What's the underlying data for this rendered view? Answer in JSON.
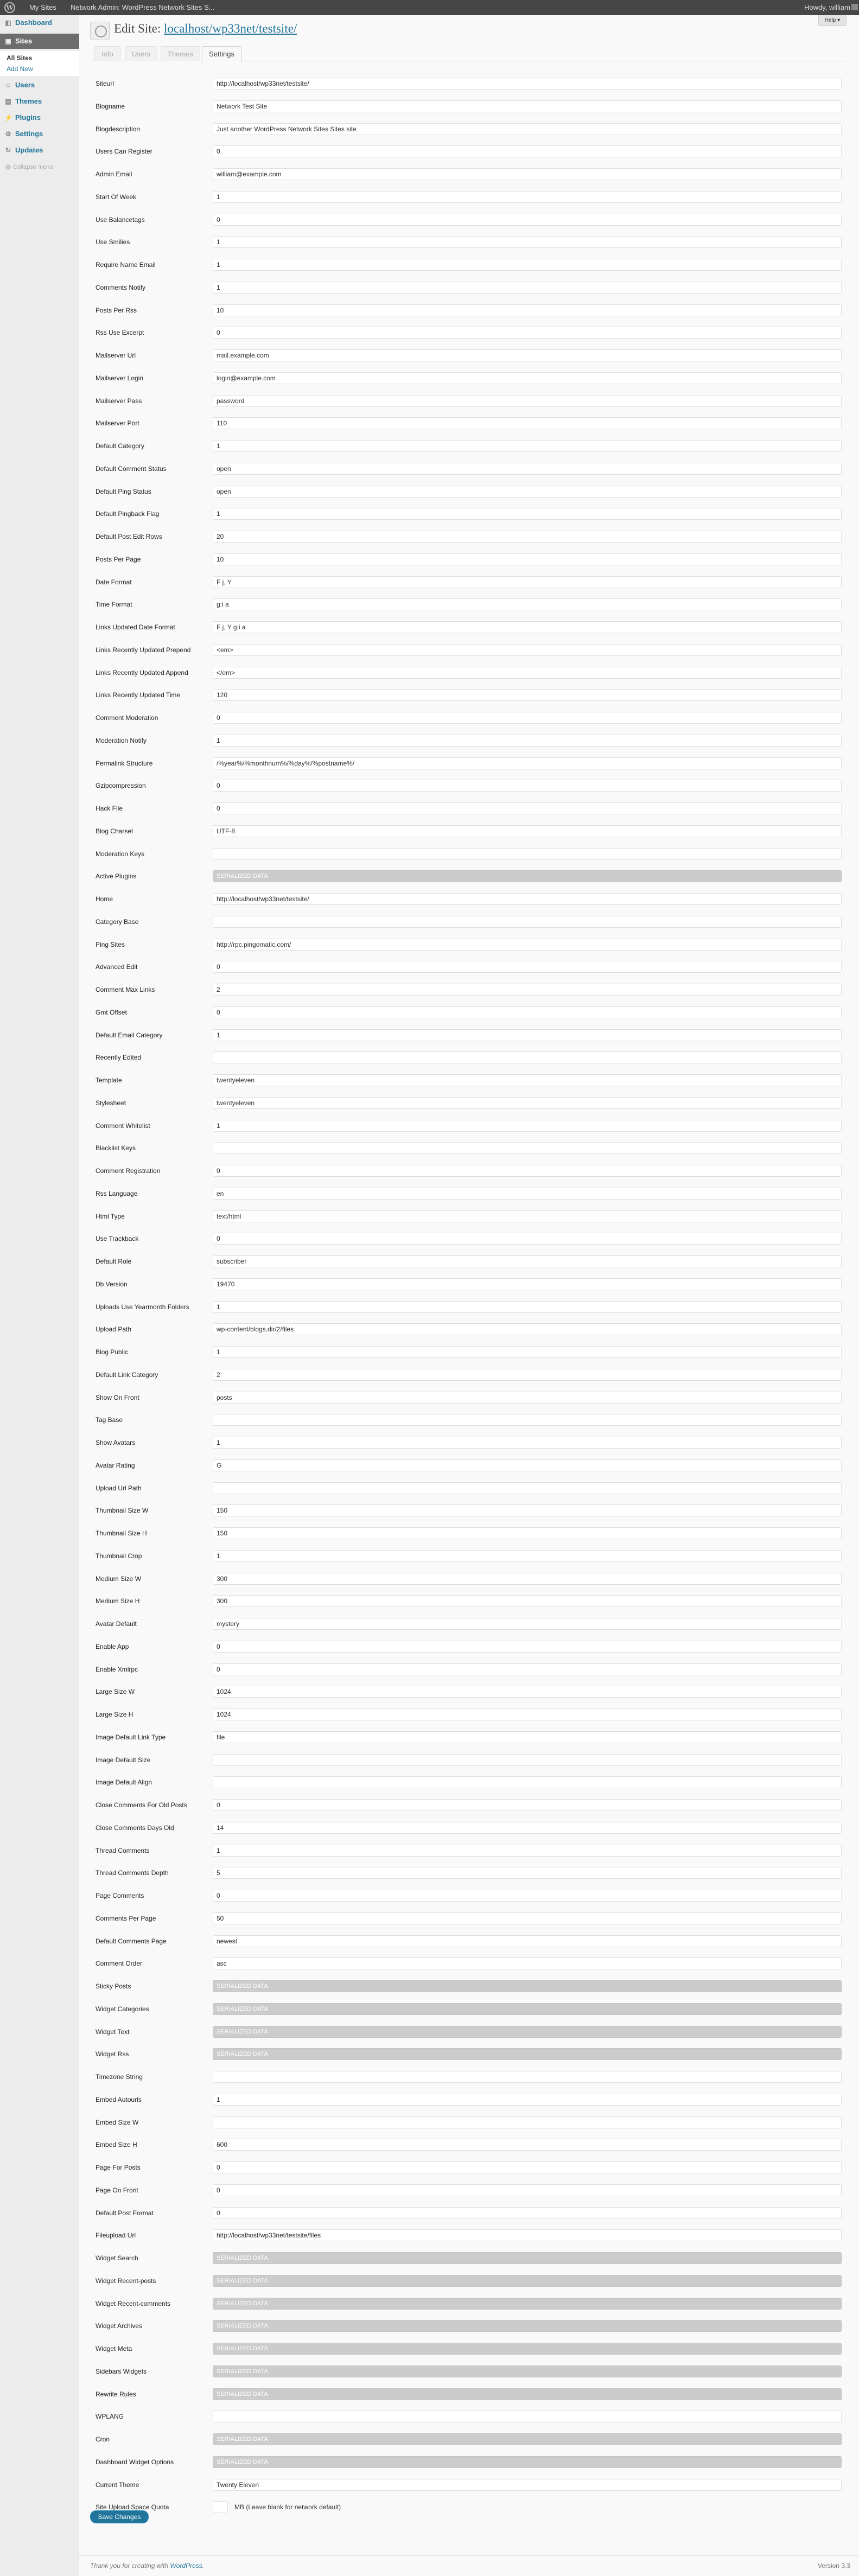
{
  "adminbar": {
    "logo": "W",
    "items": [
      "My Sites",
      "Network Admin: WordPress Network Sites S..."
    ],
    "howdy": "Howdy, william"
  },
  "sidebar": {
    "items": [
      {
        "label": "Dashboard",
        "icon": "dashboard-icon"
      },
      {
        "label": "Sites",
        "icon": "sites-icon"
      },
      {
        "label": "Users",
        "icon": "users-icon"
      },
      {
        "label": "Themes",
        "icon": "themes-icon"
      },
      {
        "label": "Plugins",
        "icon": "plugins-icon"
      },
      {
        "label": "Settings",
        "icon": "settings-icon"
      },
      {
        "label": "Updates",
        "icon": "updates-icon"
      }
    ],
    "submenu": [
      "All Sites",
      "Add New"
    ],
    "collapse": "Collapse menu"
  },
  "header": {
    "title_prefix": "Edit Site:",
    "title_link": "localhost/wp33net/testsite/",
    "help": "Help"
  },
  "tabs": [
    "Info",
    "Users",
    "Themes",
    "Settings"
  ],
  "fields": [
    {
      "label": "Siteurl",
      "value": "http://localhost/wp33net/testsite/"
    },
    {
      "label": "Blogname",
      "value": "Network Test Site"
    },
    {
      "label": "Blogdescription",
      "value": "Just another WordPress Network Sites Sites site"
    },
    {
      "label": "Users Can Register",
      "value": "0"
    },
    {
      "label": "Admin Email",
      "value": "william@example.com"
    },
    {
      "label": "Start Of Week",
      "value": "1"
    },
    {
      "label": "Use Balancetags",
      "value": "0"
    },
    {
      "label": "Use Smilies",
      "value": "1"
    },
    {
      "label": "Require Name Email",
      "value": "1"
    },
    {
      "label": "Comments Notify",
      "value": "1"
    },
    {
      "label": "Posts Per Rss",
      "value": "10"
    },
    {
      "label": "Rss Use Excerpt",
      "value": "0"
    },
    {
      "label": "Mailserver Url",
      "value": "mail.example.com"
    },
    {
      "label": "Mailserver Login",
      "value": "login@example.com"
    },
    {
      "label": "Mailserver Pass",
      "value": "password"
    },
    {
      "label": "Mailserver Port",
      "value": "110"
    },
    {
      "label": "Default Category",
      "value": "1"
    },
    {
      "label": "Default Comment Status",
      "value": "open"
    },
    {
      "label": "Default Ping Status",
      "value": "open"
    },
    {
      "label": "Default Pingback Flag",
      "value": "1"
    },
    {
      "label": "Default Post Edit Rows",
      "value": "20"
    },
    {
      "label": "Posts Per Page",
      "value": "10"
    },
    {
      "label": "Date Format",
      "value": "F j, Y"
    },
    {
      "label": "Time Format",
      "value": "g:i a"
    },
    {
      "label": "Links Updated Date Format",
      "value": "F j, Y g:i a"
    },
    {
      "label": "Links Recently Updated Prepend",
      "value": "<em>"
    },
    {
      "label": "Links Recently Updated Append",
      "value": "</em>"
    },
    {
      "label": "Links Recently Updated Time",
      "value": "120"
    },
    {
      "label": "Comment Moderation",
      "value": "0"
    },
    {
      "label": "Moderation Notify",
      "value": "1"
    },
    {
      "label": "Permalink Structure",
      "value": "/%year%/%monthnum%/%day%/%postname%/"
    },
    {
      "label": "Gzipcompression",
      "value": "0"
    },
    {
      "label": "Hack File",
      "value": "0"
    },
    {
      "label": "Blog Charset",
      "value": "UTF-8"
    },
    {
      "label": "Moderation Keys",
      "value": ""
    },
    {
      "label": "Active Plugins",
      "value": "SERIALIZED DATA",
      "disabled": true
    },
    {
      "label": "Home",
      "value": "http://localhost/wp33net/testsite/"
    },
    {
      "label": "Category Base",
      "value": ""
    },
    {
      "label": "Ping Sites",
      "value": "http://rpc.pingomatic.com/"
    },
    {
      "label": "Advanced Edit",
      "value": "0"
    },
    {
      "label": "Comment Max Links",
      "value": "2"
    },
    {
      "label": "Gmt Offset",
      "value": "0"
    },
    {
      "label": "Default Email Category",
      "value": "1"
    },
    {
      "label": "Recently Edited",
      "value": ""
    },
    {
      "label": "Template",
      "value": "twentyeleven"
    },
    {
      "label": "Stylesheet",
      "value": "twentyeleven"
    },
    {
      "label": "Comment Whitelist",
      "value": "1"
    },
    {
      "label": "Blacklist Keys",
      "value": ""
    },
    {
      "label": "Comment Registration",
      "value": "0"
    },
    {
      "label": "Rss Language",
      "value": "en"
    },
    {
      "label": "Html Type",
      "value": "text/html"
    },
    {
      "label": "Use Trackback",
      "value": "0"
    },
    {
      "label": "Default Role",
      "value": "subscriber"
    },
    {
      "label": "Db Version",
      "value": "19470"
    },
    {
      "label": "Uploads Use Yearmonth Folders",
      "value": "1"
    },
    {
      "label": "Upload Path",
      "value": "wp-content/blogs.dir/2/files"
    },
    {
      "label": "Blog Public",
      "value": "1"
    },
    {
      "label": "Default Link Category",
      "value": "2"
    },
    {
      "label": "Show On Front",
      "value": "posts"
    },
    {
      "label": "Tag Base",
      "value": ""
    },
    {
      "label": "Show Avatars",
      "value": "1"
    },
    {
      "label": "Avatar Rating",
      "value": "G"
    },
    {
      "label": "Upload Url Path",
      "value": ""
    },
    {
      "label": "Thumbnail Size W",
      "value": "150"
    },
    {
      "label": "Thumbnail Size H",
      "value": "150"
    },
    {
      "label": "Thumbnail Crop",
      "value": "1"
    },
    {
      "label": "Medium Size W",
      "value": "300"
    },
    {
      "label": "Medium Size H",
      "value": "300"
    },
    {
      "label": "Avatar Default",
      "value": "mystery"
    },
    {
      "label": "Enable App",
      "value": "0"
    },
    {
      "label": "Enable Xmlrpc",
      "value": "0"
    },
    {
      "label": "Large Size W",
      "value": "1024"
    },
    {
      "label": "Large Size H",
      "value": "1024"
    },
    {
      "label": "Image Default Link Type",
      "value": "file"
    },
    {
      "label": "Image Default Size",
      "value": ""
    },
    {
      "label": "Image Default Align",
      "value": ""
    },
    {
      "label": "Close Comments For Old Posts",
      "value": "0"
    },
    {
      "label": "Close Comments Days Old",
      "value": "14"
    },
    {
      "label": "Thread Comments",
      "value": "1"
    },
    {
      "label": "Thread Comments Depth",
      "value": "5"
    },
    {
      "label": "Page Comments",
      "value": "0"
    },
    {
      "label": "Comments Per Page",
      "value": "50"
    },
    {
      "label": "Default Comments Page",
      "value": "newest"
    },
    {
      "label": "Comment Order",
      "value": "asc"
    },
    {
      "label": "Sticky Posts",
      "value": "SERIALIZED DATA",
      "disabled": true
    },
    {
      "label": "Widget Categories",
      "value": "SERIALIZED DATA",
      "disabled": true
    },
    {
      "label": "Widget Text",
      "value": "SERIALIZED DATA",
      "disabled": true
    },
    {
      "label": "Widget Rss",
      "value": "SERIALIZED DATA",
      "disabled": true
    },
    {
      "label": "Timezone String",
      "value": ""
    },
    {
      "label": "Embed Autourls",
      "value": "1"
    },
    {
      "label": "Embed Size W",
      "value": ""
    },
    {
      "label": "Embed Size H",
      "value": "600"
    },
    {
      "label": "Page For Posts",
      "value": "0"
    },
    {
      "label": "Page On Front",
      "value": "0"
    },
    {
      "label": "Default Post Format",
      "value": "0"
    },
    {
      "label": "Fileupload Url",
      "value": "http://localhost/wp33net/testsite/files"
    },
    {
      "label": "Widget Search",
      "value": "SERIALIZED DATA",
      "disabled": true
    },
    {
      "label": "Widget Recent-posts",
      "value": "SERIALIZED DATA",
      "disabled": true
    },
    {
      "label": "Widget Recent-comments",
      "value": "SERIALIZED DATA",
      "disabled": true
    },
    {
      "label": "Widget Archives",
      "value": "SERIALIZED DATA",
      "disabled": true
    },
    {
      "label": "Widget Meta",
      "value": "SERIALIZED DATA",
      "disabled": true
    },
    {
      "label": "Sidebars Widgets",
      "value": "SERIALIZED DATA",
      "disabled": true
    },
    {
      "label": "Rewrite Rules",
      "value": "SERIALIZED DATA",
      "disabled": true
    },
    {
      "label": "WPLANG",
      "value": ""
    },
    {
      "label": "Cron",
      "value": "SERIALIZED DATA",
      "disabled": true
    },
    {
      "label": "Dashboard Widget Options",
      "value": "SERIALIZED DATA",
      "disabled": true
    },
    {
      "label": "Current Theme",
      "value": "Twenty Eleven"
    }
  ],
  "quota": {
    "label": "Site Upload Space Quota",
    "value": "",
    "description": "MB (Leave blank for network default)"
  },
  "save_button": "Save Changes",
  "footer": {
    "thanks_prefix": "Thank you for creating with",
    "thanks_link": "WordPress",
    "version": "Version 3.3"
  }
}
